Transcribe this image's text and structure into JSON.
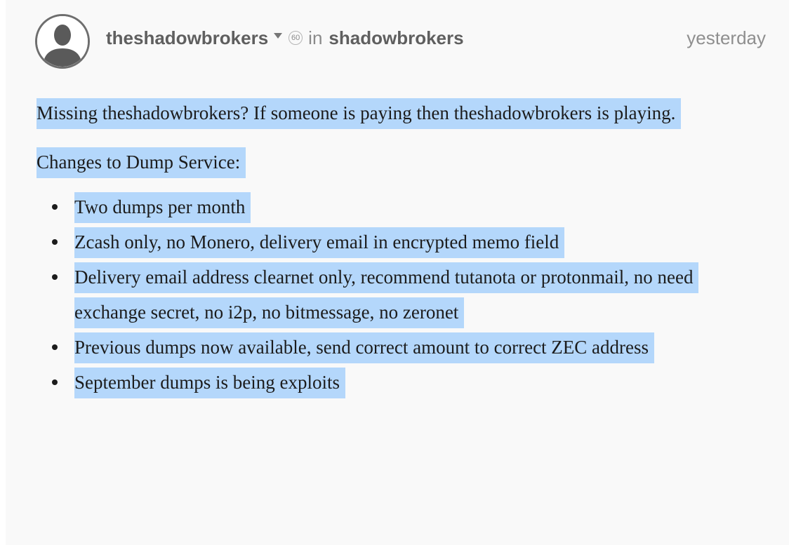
{
  "post": {
    "author": "theshadowbrokers",
    "reputation": "60",
    "in_word": "in",
    "community": "shadowbrokers",
    "timestamp": "yesterday",
    "avatar_icon": "user-silhouette-icon",
    "caret_icon": "caret-down-icon"
  },
  "body": {
    "intro": "Missing theshadowbrokers? If someone is paying then theshadowbrokers is playing.",
    "heading": "Changes to Dump Service:",
    "items": [
      "Two dumps per month",
      "Zcash only, no Monero, delivery email in encrypted memo field",
      "Delivery email address clearnet only, recommend tutanota or protonmail, no need exchange secret, no i2p, no bitmessage, no zeronet",
      "Previous dumps now available, send correct amount to correct ZEC address",
      "September dumps is being exploits"
    ]
  },
  "colors": {
    "selection_highlight": "#b4d7fb",
    "card_background": "#f9f9f9",
    "meta_text": "#6d6d6d",
    "body_text": "#1c1c1c"
  }
}
